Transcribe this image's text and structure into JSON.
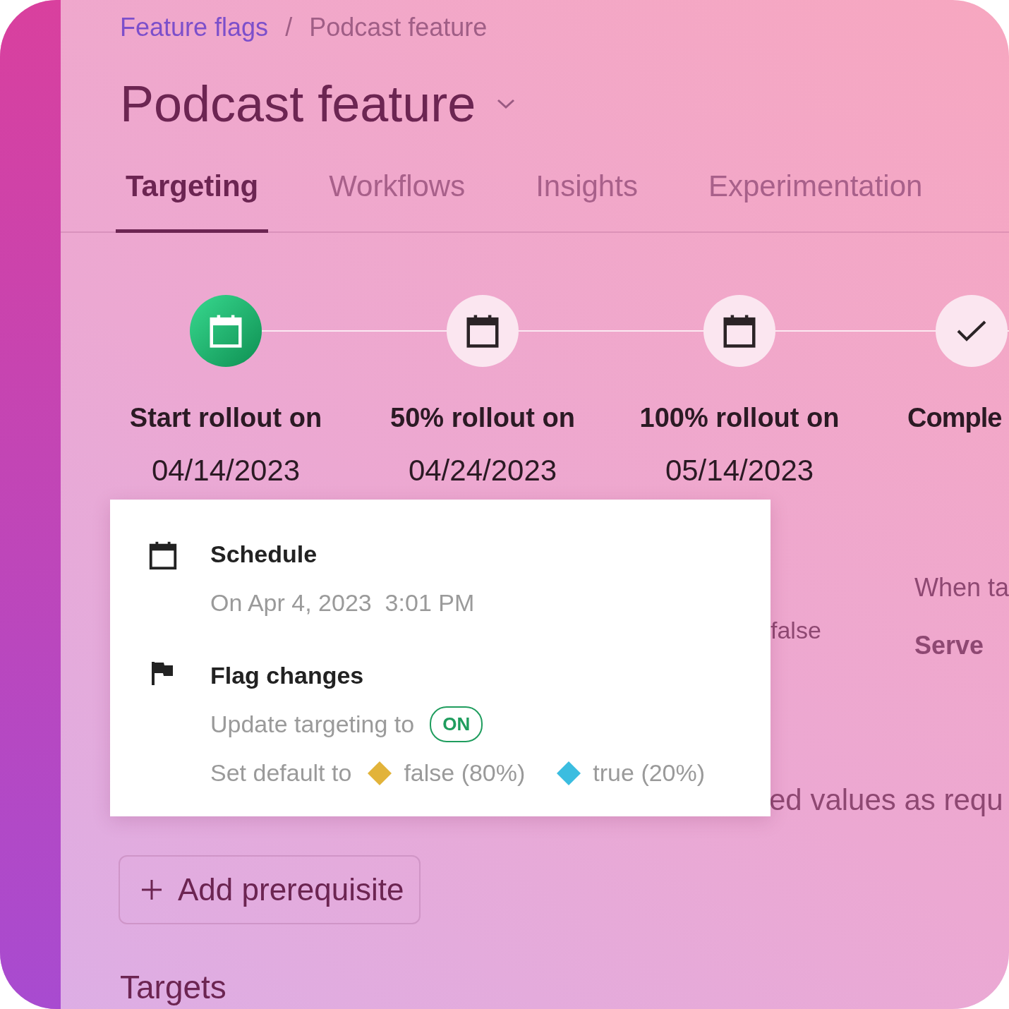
{
  "breadcrumb": [
    {
      "label": "Feature flags",
      "kind": "link"
    },
    {
      "label": "Podcast feature",
      "kind": "current"
    }
  ],
  "breadcrumb_separator": "/",
  "title": "Podcast feature",
  "tabs": [
    {
      "label": "Targeting",
      "selected": true
    },
    {
      "label": "Workflows",
      "selected": false
    },
    {
      "label": "Insights",
      "selected": false
    },
    {
      "label": "Experimentation",
      "selected": false
    }
  ],
  "steps": [
    {
      "kind": "calendar",
      "done": true,
      "label": "Start rollout on",
      "date": "04/14/2023"
    },
    {
      "kind": "calendar",
      "done": false,
      "label": "50% rollout on",
      "date": "04/24/2023"
    },
    {
      "kind": "calendar",
      "done": false,
      "label": "100% rollout on",
      "date": "05/14/2023"
    },
    {
      "kind": "check",
      "done": false,
      "label": "Comple"
    }
  ],
  "background_text": {
    "default_value": "false",
    "rule_heading": "When ta",
    "rule_serve": "Serve",
    "description": "ed values as requ"
  },
  "popover": {
    "schedule": {
      "title": "Schedule",
      "detail": "On Apr 4, 2023  3:01 PM"
    },
    "flag_changes": {
      "title": "Flag changes",
      "targeting_label": "Update targeting to",
      "targeting_badge": "ON",
      "default_label": "Set default to",
      "default_values": [
        {
          "label": "false (80%)",
          "color": "#e2b33a"
        },
        {
          "label": "true (20%)",
          "color": "#3bbde0"
        }
      ]
    }
  },
  "add_button": {
    "label": "Add prerequisite"
  },
  "section_heading": "Targets"
}
